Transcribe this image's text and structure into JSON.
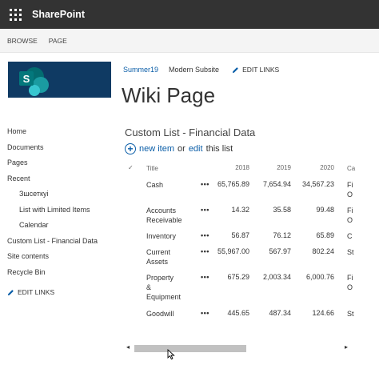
{
  "suite_bar": {
    "brand": "SharePoint"
  },
  "ribbon": {
    "tabs": [
      "BROWSE",
      "PAGE"
    ]
  },
  "site_nav": {
    "active_site": "Summer19",
    "subsite": "Modern Subsite",
    "edit_links": "EDIT LINKS"
  },
  "page": {
    "title": "Wiki Page"
  },
  "quick_launch": {
    "items": [
      {
        "label": "Home"
      },
      {
        "label": "Documents"
      },
      {
        "label": "Pages"
      },
      {
        "label": "Recent"
      },
      {
        "label": "Зшсеткуі"
      },
      {
        "label": "List with Limited Items"
      },
      {
        "label": "Calendar"
      },
      {
        "label": "Custom List - Financial Data"
      },
      {
        "label": "Site contents"
      },
      {
        "label": "Recycle Bin"
      }
    ],
    "edit_links": "EDIT LINKS"
  },
  "list": {
    "title": "Custom List - Financial Data",
    "new_item": "new item",
    "or": "or",
    "edit": "edit",
    "this_list": "this list",
    "headers": {
      "check": "✓",
      "title": "Title",
      "y2018": "2018",
      "y2019": "2019",
      "y2020": "2020",
      "cat": "Ca"
    },
    "rows": [
      {
        "title": "Cash",
        "dots": "•••",
        "y2018": "65,765.89",
        "y2019": "7,654.94",
        "y2020": "34,567.23",
        "cat": "Fi\nO"
      },
      {
        "title": "Accounts\nReceivable",
        "dots": "•••",
        "y2018": "14.32",
        "y2019": "35.58",
        "y2020": "99.48",
        "cat": "Fi\nO"
      },
      {
        "title": "Inventory",
        "dots": "•••",
        "y2018": "56.87",
        "y2019": "76.12",
        "y2020": "65.89",
        "cat": "C"
      },
      {
        "title": "Current\nAssets",
        "dots": "•••",
        "y2018": "55,967.00",
        "y2019": "567.97",
        "y2020": "802.24",
        "cat": "St"
      },
      {
        "title": "Property\n&\nEquipment",
        "dots": "•••",
        "y2018": "675.29",
        "y2019": "2,003.34",
        "y2020": "6,000.76",
        "cat": "Fi\nO"
      },
      {
        "title": "Goodwill",
        "dots": "•••",
        "y2018": "445.65",
        "y2019": "487.34",
        "y2020": "124.66",
        "cat": "St"
      }
    ]
  },
  "scrollbar": {
    "left_arrow": "◂",
    "right_arrow": "▸"
  },
  "colors": {
    "suite_bar": "#333333",
    "link": "#0b5ea8",
    "logo_bg": "#0f3a63"
  }
}
